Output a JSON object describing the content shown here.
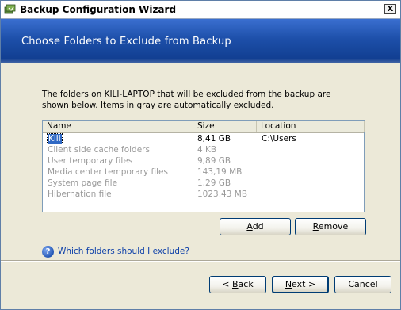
{
  "window": {
    "title": "Backup Configuration Wizard",
    "close_label": "X"
  },
  "header": {
    "title": "Choose Folders to Exclude from  Backup"
  },
  "description": "The folders on KILI-LAPTOP that will be excluded from the backup are shown below. Items in gray are automatically excluded.",
  "list": {
    "columns": [
      "Name",
      "Size",
      "Location"
    ],
    "rows": [
      {
        "name": "Kili",
        "size": "8,41 GB",
        "location": "C:\\Users",
        "gray": false,
        "selected": true
      },
      {
        "name": "Client side cache folders",
        "size": "4 KB",
        "location": "",
        "gray": true
      },
      {
        "name": "User temporary files",
        "size": "9,89 GB",
        "location": "",
        "gray": true
      },
      {
        "name": "Media center temporary files",
        "size": "143,19 MB",
        "location": "",
        "gray": true
      },
      {
        "name": "System page file",
        "size": "1,29 GB",
        "location": "",
        "gray": true
      },
      {
        "name": "Hibernation file",
        "size": "1023,43 MB",
        "location": "",
        "gray": true
      }
    ]
  },
  "buttons": {
    "add": {
      "pre": "",
      "acc": "A",
      "post": "dd"
    },
    "remove": {
      "pre": "",
      "acc": "R",
      "post": "emove"
    },
    "back": {
      "pre": "< ",
      "acc": "B",
      "post": "ack"
    },
    "next": {
      "pre": "",
      "acc": "N",
      "post": "ext >"
    },
    "cancel": {
      "pre": "Cancel",
      "acc": "",
      "post": ""
    }
  },
  "help": {
    "icon": "help-question-icon",
    "link": "Which folders should I exclude?"
  },
  "colors": {
    "header_band": "#1d4fa9",
    "link": "#0b3ea8",
    "gray_text": "#9a9a9a",
    "selection": "#316ac5"
  }
}
